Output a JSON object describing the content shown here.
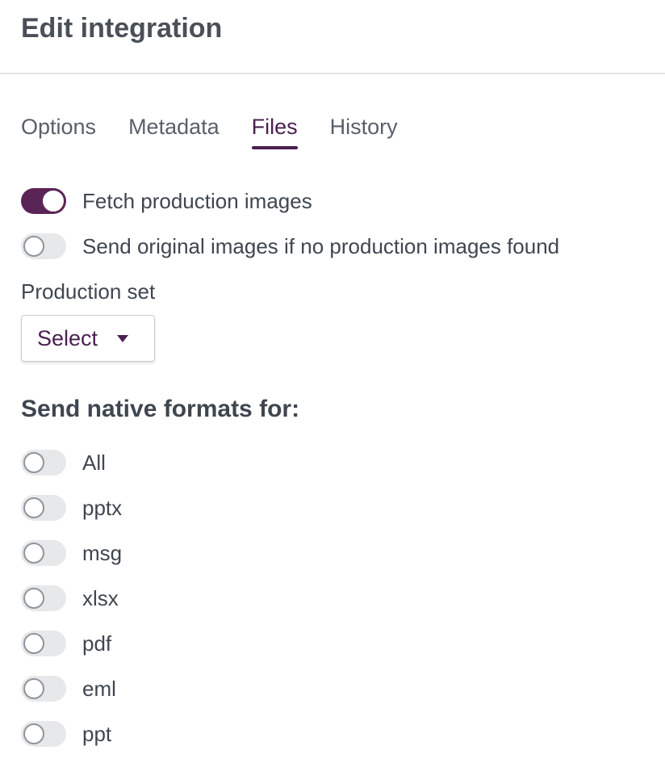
{
  "header": {
    "title": "Edit integration"
  },
  "tabs": [
    {
      "label": "Options",
      "active": false
    },
    {
      "label": "Metadata",
      "active": false
    },
    {
      "label": "Files",
      "active": true
    },
    {
      "label": "History",
      "active": false
    }
  ],
  "toggles": {
    "fetch_production": {
      "label": "Fetch production images",
      "on": true
    },
    "send_original": {
      "label": "Send original images if no production images found",
      "on": false
    }
  },
  "production_set": {
    "label": "Production set",
    "select_value": "Select"
  },
  "native_formats": {
    "title": "Send native formats for:",
    "items": [
      {
        "label": "All",
        "on": false
      },
      {
        "label": "pptx",
        "on": false
      },
      {
        "label": "msg",
        "on": false
      },
      {
        "label": "xlsx",
        "on": false
      },
      {
        "label": "pdf",
        "on": false
      },
      {
        "label": "eml",
        "on": false
      },
      {
        "label": "ppt",
        "on": false
      }
    ]
  },
  "colors": {
    "accent": "#5a2456",
    "text": "#3f4650",
    "toggle_off": "#e7e8ea"
  }
}
